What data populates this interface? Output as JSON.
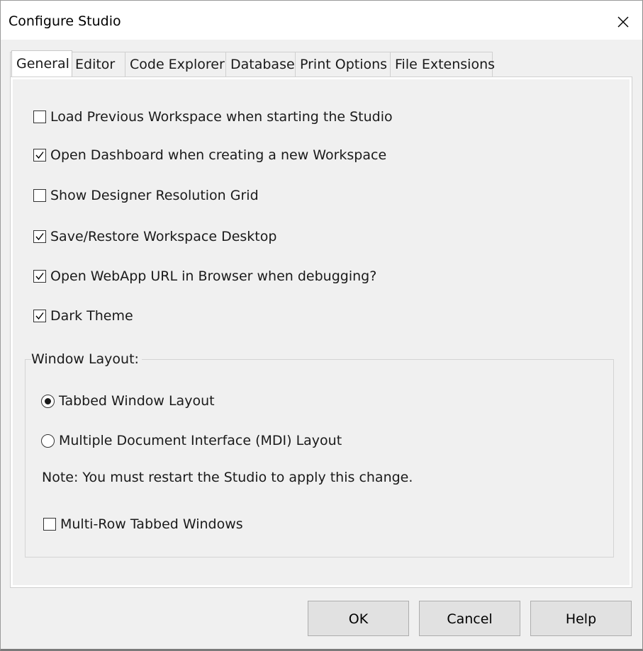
{
  "window": {
    "title": "Configure Studio"
  },
  "tabs": [
    {
      "label": "General",
      "active": true
    },
    {
      "label": "Editor",
      "active": false
    },
    {
      "label": "Code Explorer",
      "active": false
    },
    {
      "label": "Database",
      "active": false
    },
    {
      "label": "Print Options",
      "active": false
    },
    {
      "label": "File Extensions",
      "active": false
    }
  ],
  "general": {
    "options": [
      {
        "label": "Load Previous Workspace when starting the Studio",
        "checked": false
      },
      {
        "label": "Open Dashboard when creating a new Workspace",
        "checked": true
      },
      {
        "label": "Show Designer Resolution Grid",
        "checked": false
      },
      {
        "label": "Save/Restore Workspace Desktop",
        "checked": true
      },
      {
        "label": "Open WebApp URL in Browser when debugging?",
        "checked": true
      },
      {
        "label": "Dark Theme",
        "checked": true
      }
    ],
    "window_layout": {
      "label": "Window Layout:",
      "radios": [
        {
          "label": "Tabbed Window Layout",
          "selected": true
        },
        {
          "label": "Multiple Document Interface (MDI) Layout",
          "selected": false
        }
      ],
      "note": "Note: You must restart the Studio to apply this change.",
      "multi_row": {
        "label": "Multi-Row Tabbed Windows",
        "checked": false
      }
    }
  },
  "buttons": {
    "ok": "OK",
    "cancel": "Cancel",
    "help": "Help"
  },
  "icons": {
    "close": "close-icon",
    "check": "checkmark-icon"
  }
}
